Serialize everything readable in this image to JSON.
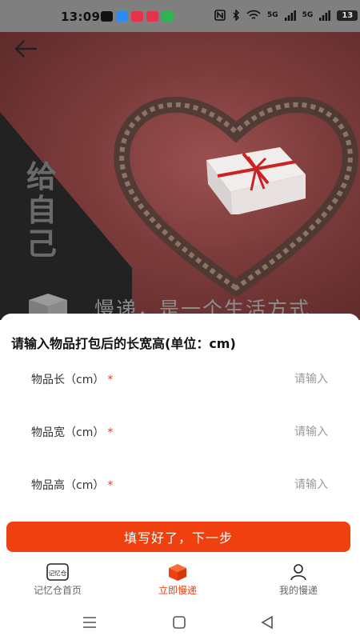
{
  "status": {
    "time": "13:09",
    "signal1": "5G",
    "signal2": "5G",
    "battery": "13",
    "apps": [
      {
        "name": "tiktok-icon",
        "color": "#111111"
      },
      {
        "name": "video-icon",
        "color": "#2a8cf0"
      },
      {
        "name": "mail-icon",
        "color": "#e8324a"
      },
      {
        "name": "store-icon",
        "color": "#e8324a"
      },
      {
        "name": "message-icon",
        "color": "#2fb455"
      }
    ]
  },
  "hero": {
    "vertical_text": "给\n自\n己",
    "slogan": "慢递，是一个生活方式"
  },
  "form": {
    "title": "请输入物品打包后的长宽高(单位：cm)",
    "fields": [
      {
        "label": "物品长（cm）",
        "required": "*",
        "placeholder": "请输入",
        "value": ""
      },
      {
        "label": "物品宽（cm）",
        "required": "*",
        "placeholder": "请输入",
        "value": ""
      },
      {
        "label": "物品高（cm）",
        "required": "*",
        "placeholder": "请输入",
        "value": ""
      }
    ],
    "submit_label": "填写好了，下一步"
  },
  "tabs": [
    {
      "label": "记忆仓首页",
      "icon": "memory-box-icon",
      "icon_text": "记忆仓",
      "active": false
    },
    {
      "label": "立即慢递",
      "icon": "package-icon",
      "active": true
    },
    {
      "label": "我的慢递",
      "icon": "user-icon",
      "active": false
    }
  ],
  "colors": {
    "accent": "#f1400f",
    "required": "#e53b1c"
  }
}
